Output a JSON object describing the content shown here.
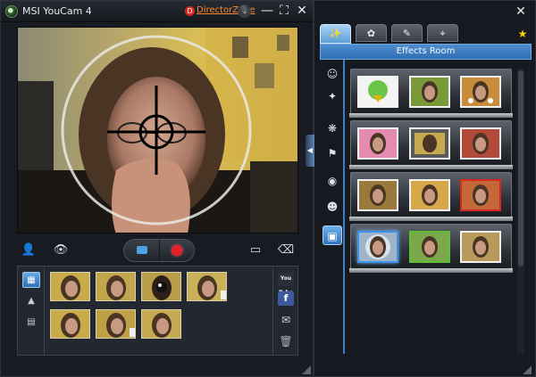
{
  "app": {
    "title": "MSI YouCam 4",
    "directorzone_label": "DirectorZone",
    "mic_glyph": "🎙",
    "min_glyph": "—",
    "max_glyph": "⛶",
    "close_glyph": "✕"
  },
  "controls": {
    "add_user_glyph": "👤",
    "eye_glyph": "👁",
    "frame_glyph": "▭",
    "eraser_glyph": "⌫"
  },
  "gallery": {
    "tool_glyphs": [
      "▦",
      "▲",
      "▤"
    ],
    "share": {
      "youtube_label": "You Tube",
      "facebook_label": "f",
      "mail_glyph": "✉",
      "trash_glyph": "🗑"
    }
  },
  "effects_panel": {
    "close_glyph": "✕",
    "tabs": [
      {
        "icon": "wand-icon",
        "glyph": "✨",
        "active": true
      },
      {
        "icon": "flower-icon",
        "glyph": "✿",
        "active": false
      },
      {
        "icon": "pen-icon",
        "glyph": "✎",
        "active": false
      },
      {
        "icon": "camera-icon",
        "glyph": "⌖",
        "active": false
      }
    ],
    "room_title": "Effects Room",
    "categories": [
      {
        "icon": "avatar-icon",
        "glyph": "☺",
        "active": false
      },
      {
        "icon": "magic-wand-icon",
        "glyph": "✦",
        "active": false
      },
      {
        "icon": "particles-icon",
        "glyph": "❋",
        "active": false
      },
      {
        "icon": "distortion-icon",
        "glyph": "⚑",
        "active": false
      },
      {
        "icon": "mask-icon",
        "glyph": "◉",
        "active": false
      },
      {
        "icon": "emotion-icon",
        "glyph": "☻",
        "active": false
      },
      {
        "icon": "frame-icon",
        "glyph": "▣",
        "active": true
      }
    ]
  },
  "colors": {
    "accent": "#3d93ea",
    "record": "#e5212b",
    "directorzone": "#ff8a2a"
  }
}
